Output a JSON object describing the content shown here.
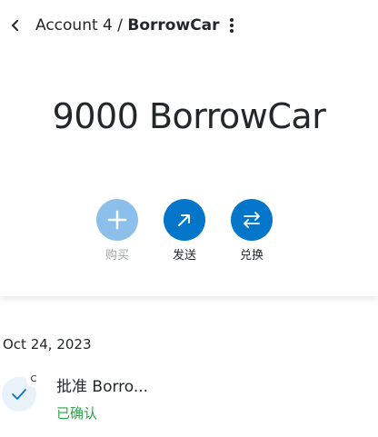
{
  "header": {
    "account": "Account 4",
    "separator": " / ",
    "token": "BorrowCar",
    "back_icon": "chevron-left-icon",
    "more_icon": "more-vertical-icon"
  },
  "balance": {
    "amount": "9000",
    "symbol": "BorrowCar"
  },
  "actions": [
    {
      "label": "购买",
      "icon": "plus-icon",
      "enabled": false
    },
    {
      "label": "发送",
      "icon": "arrow-up-right-icon",
      "enabled": true
    },
    {
      "label": "兑换",
      "icon": "swap-arrows-icon",
      "enabled": true
    }
  ],
  "activity": {
    "date": "Oct 24, 2023",
    "items": [
      {
        "title": "批准 Borro...",
        "status": "已确认",
        "badge": "C",
        "icon": "check-icon"
      }
    ]
  },
  "colors": {
    "accent": "#0376c9",
    "accent_disabled": "#8cc0ea",
    "success": "#28a745",
    "text": "#24272a"
  }
}
